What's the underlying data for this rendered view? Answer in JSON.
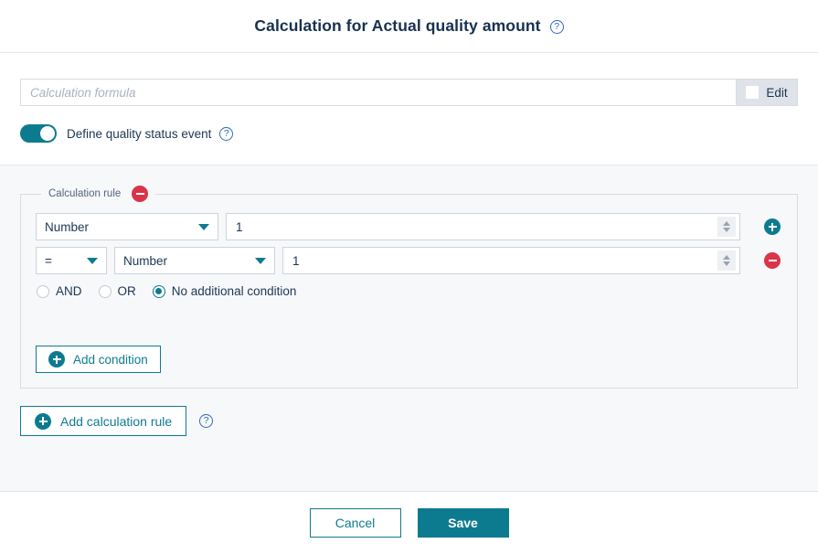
{
  "header": {
    "title": "Calculation for Actual quality amount",
    "help_icon": "help-circle-icon",
    "help_glyph": "?"
  },
  "formula": {
    "placeholder": "Calculation formula",
    "value": "",
    "edit_label": "Edit"
  },
  "quality_event": {
    "toggle_state": "on",
    "label": "Define quality status event",
    "help_glyph": "?"
  },
  "calculation_rule": {
    "legend": "Calculation rule",
    "remove_rule_icon": "circle-minus-icon",
    "rows": [
      {
        "type_value": "Number",
        "number_value": "1",
        "action_icon": "circle-plus-icon"
      },
      {
        "operator_value": "=",
        "type_value": "Number",
        "number_value": "1",
        "action_icon": "circle-minus-icon"
      }
    ],
    "conditions": [
      {
        "label": "AND",
        "selected": false
      },
      {
        "label": "OR",
        "selected": false
      },
      {
        "label": "No additional condition",
        "selected": true
      }
    ],
    "add_condition_label": "Add condition",
    "add_condition_icon": "circle-plus-icon"
  },
  "add_rule": {
    "label": "Add calculation rule",
    "icon": "circle-plus-icon",
    "help_glyph": "?"
  },
  "footer": {
    "cancel_label": "Cancel",
    "save_label": "Save"
  },
  "colors": {
    "accent_teal": "#0d7b8f",
    "danger_red": "#d9344a",
    "help_blue": "#2b6cb8",
    "text_navy": "#1c3553",
    "panel_gray": "#f7f8fa"
  }
}
